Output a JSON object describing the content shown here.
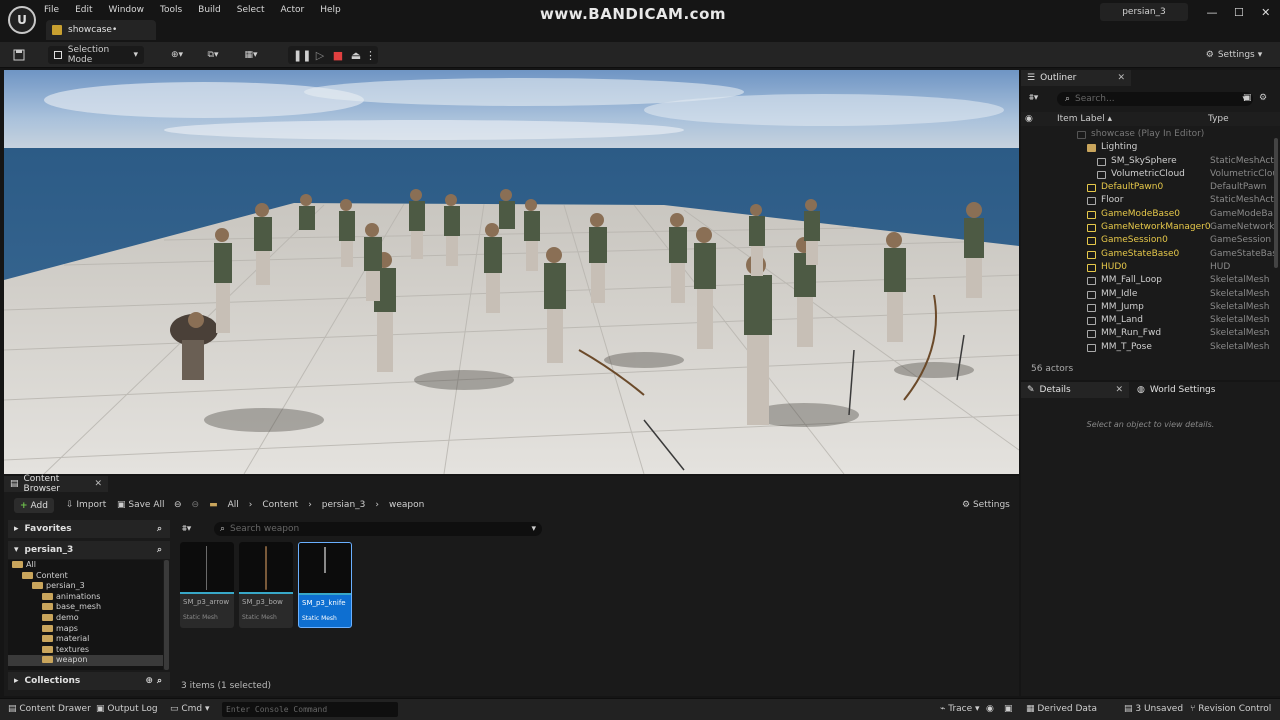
{
  "menu": [
    "File",
    "Edit",
    "Window",
    "Tools",
    "Build",
    "Select",
    "Actor",
    "Help"
  ],
  "document_tab": "showcase•",
  "watermark": "www.BANDICAM.com",
  "project_name": "persian_3",
  "window_controls": {
    "minimize": "—",
    "maximize": "☐",
    "close": "✕"
  },
  "toolbar": {
    "selection_mode": "Selection Mode",
    "settings": "Settings",
    "play_controls": [
      "pause",
      "step",
      "stop",
      "eject"
    ]
  },
  "outliner": {
    "tab_title": "Outliner",
    "search_placeholder": "Search...",
    "col_item_label": "Item Label ▴",
    "col_type": "Type",
    "rows": [
      {
        "label": "showcase (Play In Editor)",
        "type": "",
        "indent": 1,
        "dim": true
      },
      {
        "label": "Lighting",
        "type": "",
        "indent": 2,
        "folder": true
      },
      {
        "label": "SM_SkySphere",
        "type": "StaticMeshAct",
        "indent": 3
      },
      {
        "label": "VolumetricCloud",
        "type": "VolumetricClou",
        "indent": 3
      },
      {
        "label": "DefaultPawn0",
        "type": "DefaultPawn",
        "indent": 2,
        "yellow": true
      },
      {
        "label": "Floor",
        "type": "StaticMeshAct",
        "indent": 2
      },
      {
        "label": "GameModeBase0",
        "type": "GameModeBa",
        "indent": 2,
        "yellow": true
      },
      {
        "label": "GameNetworkManager0",
        "type": "GameNetwork",
        "indent": 2,
        "yellow": true
      },
      {
        "label": "GameSession0",
        "type": "GameSession",
        "indent": 2,
        "yellow": true
      },
      {
        "label": "GameStateBase0",
        "type": "GameStateBas",
        "indent": 2,
        "yellow": true
      },
      {
        "label": "HUD0",
        "type": "HUD",
        "indent": 2,
        "yellow": true
      },
      {
        "label": "MM_Fall_Loop",
        "type": "SkeletalMesh",
        "indent": 2
      },
      {
        "label": "MM_Idle",
        "type": "SkeletalMesh",
        "indent": 2
      },
      {
        "label": "MM_Jump",
        "type": "SkeletalMesh",
        "indent": 2
      },
      {
        "label": "MM_Land",
        "type": "SkeletalMesh",
        "indent": 2
      },
      {
        "label": "MM_Run_Fwd",
        "type": "SkeletalMesh",
        "indent": 2
      },
      {
        "label": "MM_T_Pose",
        "type": "SkeletalMesh",
        "indent": 2
      }
    ],
    "actors_count": "56 actors"
  },
  "details": {
    "tab_title": "Details",
    "world_settings_tab": "World Settings",
    "hint": "Select an object to view details."
  },
  "content_browser": {
    "tab_title": "Content Browser",
    "add": "Add",
    "import": "Import",
    "save_all": "Save All",
    "breadcrumb": [
      "All",
      "Content",
      "persian_3",
      "weapon"
    ],
    "settings": "Settings",
    "favorites": "Favorites",
    "project_section": "persian_3",
    "collections": "Collections",
    "tree": [
      {
        "label": "All",
        "indent": 0
      },
      {
        "label": "Content",
        "indent": 1
      },
      {
        "label": "persian_3",
        "indent": 2
      },
      {
        "label": "animations",
        "indent": 3
      },
      {
        "label": "base_mesh",
        "indent": 3
      },
      {
        "label": "demo",
        "indent": 3
      },
      {
        "label": "maps",
        "indent": 3
      },
      {
        "label": "material",
        "indent": 3
      },
      {
        "label": "textures",
        "indent": 3
      },
      {
        "label": "weapon",
        "indent": 3,
        "selected": true
      }
    ],
    "search_placeholder": "Search weapon",
    "assets": [
      {
        "name": "SM_p3_arrow",
        "kind": "Static Mesh",
        "selected": false
      },
      {
        "name": "SM_p3_bow",
        "kind": "Static Mesh",
        "selected": false
      },
      {
        "name": "SM_p3_knife",
        "kind": "Static Mesh",
        "selected": true
      }
    ],
    "items_count": "3 items (1 selected)"
  },
  "statusbar": {
    "content_drawer": "Content Drawer",
    "output_log": "Output Log",
    "cmd": "Cmd",
    "console_placeholder": "Enter Console Command",
    "trace": "Trace",
    "derived_data": "Derived Data",
    "unsaved": "3 Unsaved",
    "revision_control": "Revision Control"
  },
  "colors": {
    "accent": "#0e6fd1",
    "folder": "#c9a55c",
    "actor_yellow": "#e6c84a",
    "add_green": "#6ec14c"
  }
}
